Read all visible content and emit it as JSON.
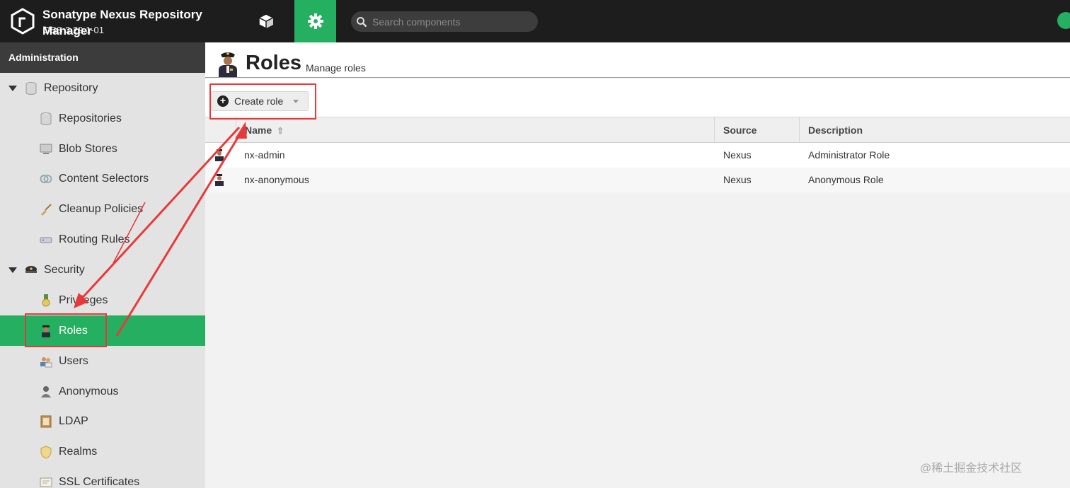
{
  "header": {
    "brand_title": "Sonatype Nexus Repository Manager",
    "brand_subtitle": "OSS 3.29.1-01",
    "search_placeholder": "Search components",
    "nav": [
      {
        "name": "browse",
        "icon": "cube-icon"
      },
      {
        "name": "administration",
        "icon": "gear-icon",
        "active": true
      }
    ],
    "status_icon": "check-circle-icon"
  },
  "sidebar": {
    "heading": "Administration",
    "groups": [
      {
        "label": "Repository",
        "icon": "database-icon",
        "expanded": true,
        "items": [
          {
            "label": "Repositories",
            "icon": "database-icon"
          },
          {
            "label": "Blob Stores",
            "icon": "server-icon"
          },
          {
            "label": "Content Selectors",
            "icon": "selector-icon"
          },
          {
            "label": "Cleanup Policies",
            "icon": "broom-icon"
          },
          {
            "label": "Routing Rules",
            "icon": "router-icon"
          }
        ]
      },
      {
        "label": "Security",
        "icon": "police-hat-icon",
        "expanded": true,
        "items": [
          {
            "label": "Privileges",
            "icon": "medal-icon"
          },
          {
            "label": "Roles",
            "icon": "officer-icon",
            "selected": true
          },
          {
            "label": "Users",
            "icon": "users-icon"
          },
          {
            "label": "Anonymous",
            "icon": "anonymous-user-icon"
          },
          {
            "label": "LDAP",
            "icon": "address-book-icon"
          },
          {
            "label": "Realms",
            "icon": "shield-icon"
          },
          {
            "label": "SSL Certificates",
            "icon": "certificate-icon"
          }
        ]
      }
    ]
  },
  "page": {
    "title": "Roles",
    "subtitle": "Manage roles",
    "icon": "officer-icon",
    "create_button": "Create role"
  },
  "table": {
    "columns": [
      "Name",
      "Source",
      "Description"
    ],
    "sort_column": "Name",
    "sort_direction": "ascending",
    "rows": [
      {
        "name": "nx-admin",
        "source": "Nexus",
        "description": "Administrator Role"
      },
      {
        "name": "nx-anonymous",
        "source": "Nexus",
        "description": "Anonymous Role"
      }
    ]
  },
  "colors": {
    "accent": "#25b061",
    "header_bg": "#1d1d1d",
    "annotation": "#e8393a"
  },
  "watermark": "@稀土掘金技术社区"
}
